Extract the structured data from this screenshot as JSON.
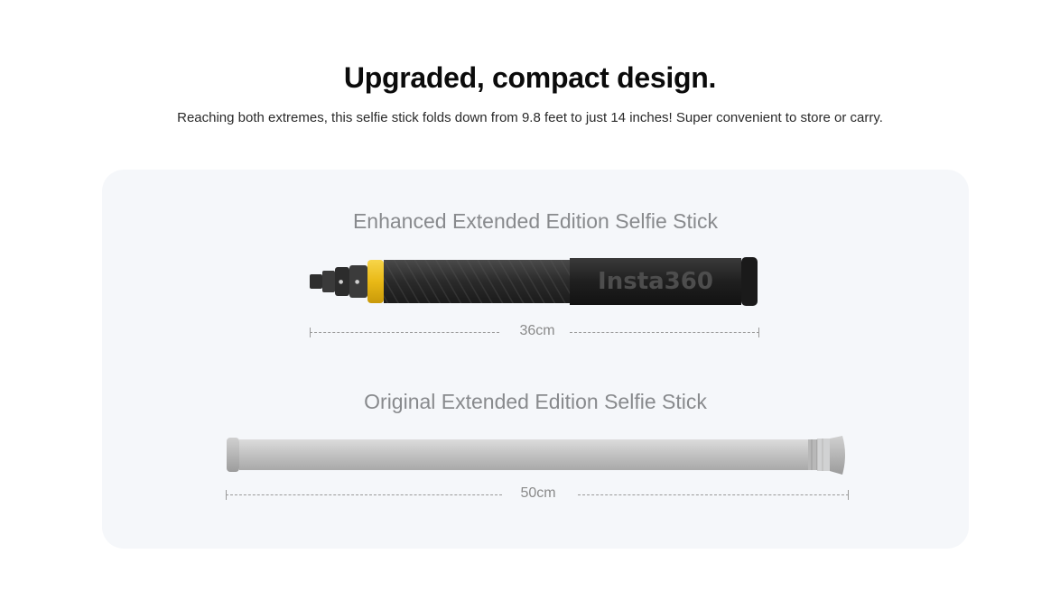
{
  "header": {
    "title": "Upgraded, compact design.",
    "subtitle": "Reaching both extremes, this selfie stick folds down from 9.8 feet to just 14 inches! Super convenient to store or carry."
  },
  "comparison": {
    "enhanced": {
      "title": "Enhanced Extended Edition Selfie Stick",
      "brand_text": "Insta360",
      "length_label": "36cm"
    },
    "original": {
      "title": "Original Extended Edition Selfie Stick",
      "length_label": "50cm"
    }
  },
  "colors": {
    "panel_bg": "#f5f7fa",
    "accent_ring": "#f2c21b",
    "stick_dark": "#2b2b2b",
    "stick_silver": "#c9c9c9"
  }
}
